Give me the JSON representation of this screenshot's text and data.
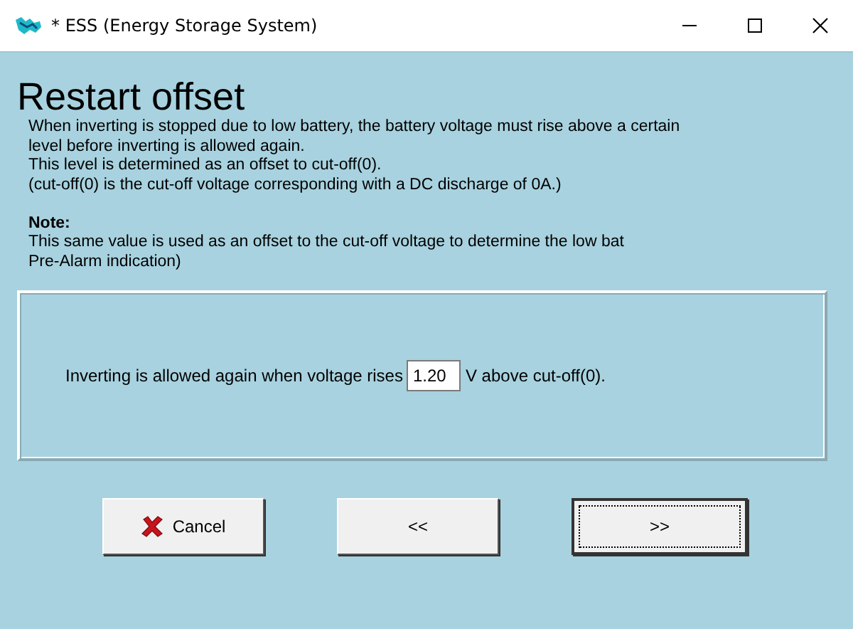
{
  "window": {
    "title": "* ESS (Energy Storage System)"
  },
  "heading": "Restart offset",
  "description": [
    "When inverting is stopped due to low battery, the battery voltage must rise above a certain",
    "level before inverting is allowed again.",
    "This level is determined as an offset to cut-off(0).",
    "(cut-off(0) is the cut-off voltage corresponding with a DC discharge of 0A.)"
  ],
  "note": {
    "title": "Note:",
    "lines": [
      "This same value is used as an offset to the cut-off voltage to determine the low bat",
      "Pre-Alarm indication)"
    ]
  },
  "setting": {
    "label": "Inverting is allowed again when voltage rises",
    "value": "1.20",
    "suffix": "V above cut-off(0)."
  },
  "buttons": [
    {
      "label": "Cancel",
      "kind": "cancel",
      "focused": false
    },
    {
      "label": "<<",
      "kind": "plain",
      "focused": false
    },
    {
      "label": ">>",
      "kind": "plain",
      "focused": true
    }
  ]
}
